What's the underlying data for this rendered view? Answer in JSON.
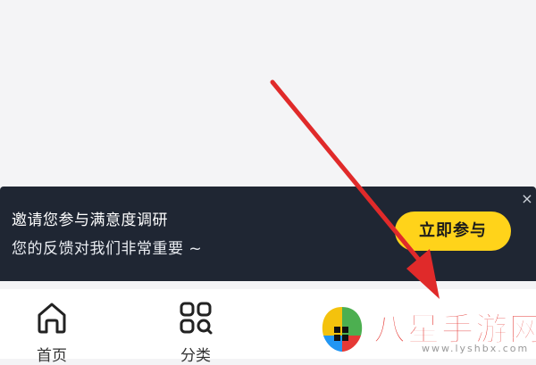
{
  "survey": {
    "title": "邀请您参与满意度调研",
    "subtitle": "您的反馈对我们非常重要 ~",
    "button_label": "立即参与",
    "close_glyph": "×"
  },
  "nav": {
    "items": [
      {
        "label": "首页",
        "icon": "home-icon"
      },
      {
        "label": "分类",
        "icon": "category-grid-icon"
      }
    ]
  },
  "watermark": {
    "name": "八星手游网",
    "url": "www.lyshbx.com"
  },
  "colors": {
    "banner_bg": "#1f2633",
    "button_bg": "#ffd31a",
    "arrow": "#e02a2a",
    "watermark_text": "#e53935"
  }
}
